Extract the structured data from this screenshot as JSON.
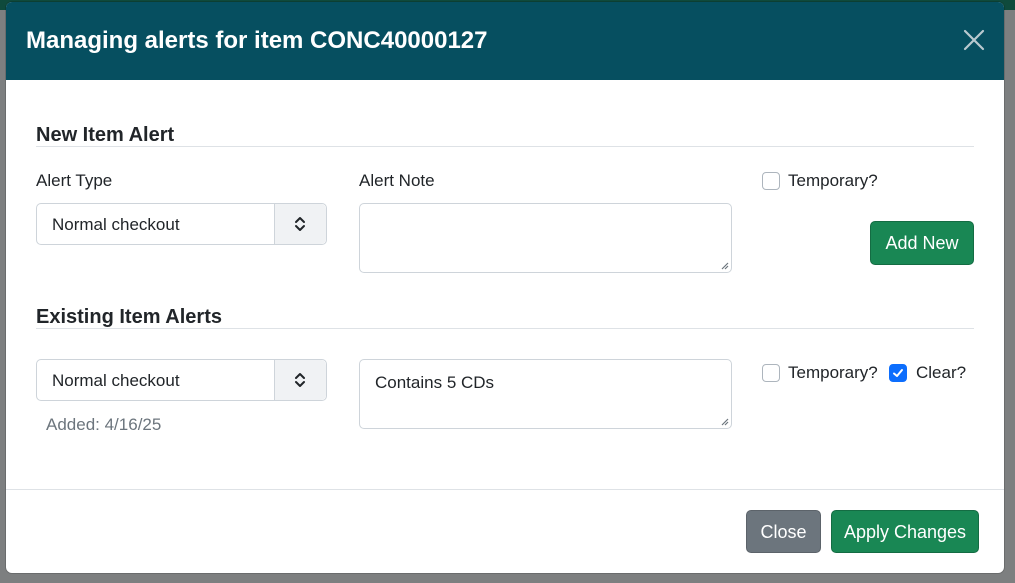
{
  "dialog": {
    "title": "Managing alerts for item CONC40000127",
    "close_icon": "close-icon"
  },
  "new_alert": {
    "section_title": "New Item Alert",
    "alert_type_label": "Alert Type",
    "alert_type_value": "Normal checkout",
    "alert_note_label": "Alert Note",
    "alert_note_value": "",
    "temporary_label": "Temporary?",
    "temporary_checked": false,
    "add_button": "Add New"
  },
  "existing_alerts": {
    "section_title": "Existing Item Alerts",
    "items": [
      {
        "alert_type_value": "Normal checkout",
        "added": "Added: 4/16/25",
        "note": "Contains 5 CDs",
        "temporary_label": "Temporary?",
        "temporary_checked": false,
        "clear_label": "Clear?",
        "clear_checked": true
      }
    ]
  },
  "footer": {
    "close_button": "Close",
    "apply_button": "Apply Changes"
  },
  "colors": {
    "header": "#064f60",
    "success": "#198754",
    "secondary": "#6c757d",
    "checkbox_checked": "#0d6efd"
  }
}
